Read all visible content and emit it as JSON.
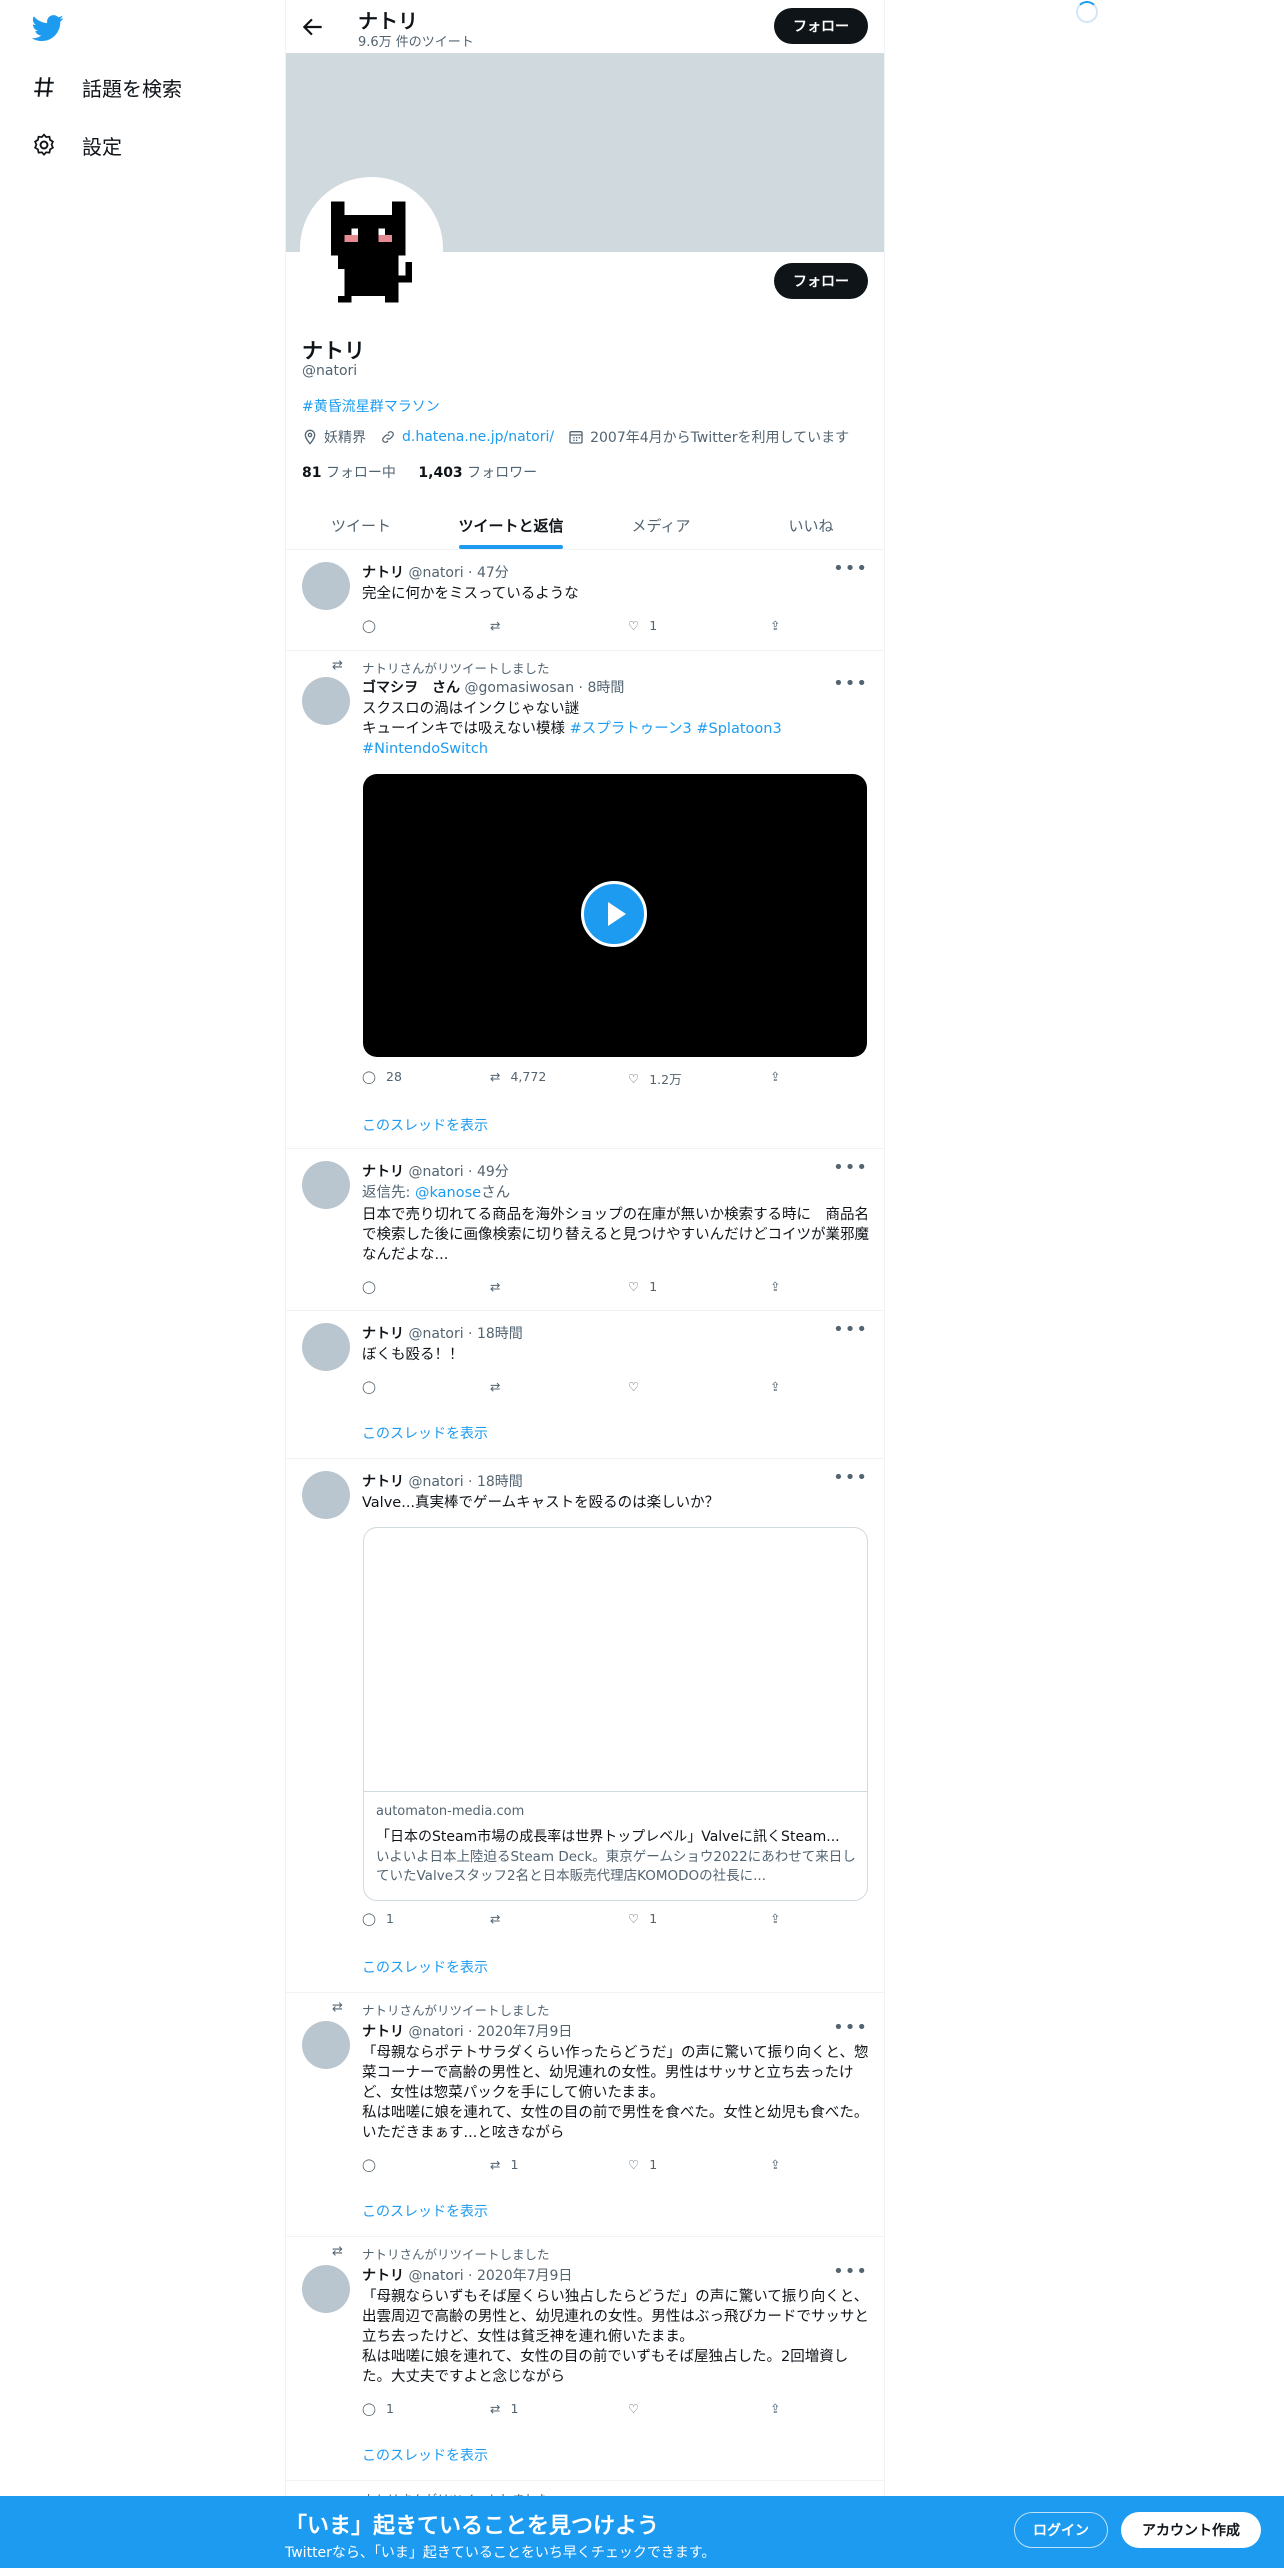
{
  "nav": {
    "explore_label": "話題を検索",
    "settings_label": "設定"
  },
  "header": {
    "name": "ナトリ",
    "tweet_count": "9.6万 件のツイート",
    "follow_label": "フォロー"
  },
  "profile": {
    "name": "ナトリ",
    "handle": "@natori",
    "bio_hashtag": "#黄昏流星群マラソン",
    "location": "妖精界",
    "url": "d.hatena.ne.jp/natori/",
    "joined": "2007年4月からTwitterを利用しています",
    "following_count": "81",
    "following_label": "フォロー中",
    "followers_count": "1,403",
    "followers_label": "フォロワー",
    "follow_label": "フォロー"
  },
  "tabs": [
    "ツイート",
    "ツイートと返信",
    "メディア",
    "いいね"
  ],
  "tweets": [
    {
      "name": "ナトリ",
      "handle": "@natori",
      "time": "47分",
      "text": "完全に何かをミスっているような",
      "reply": "",
      "retweet": "",
      "like": "1"
    },
    {
      "retweeted_by": "ナトリさんがリツイートしました",
      "name": "ゴマシヲ　さん",
      "handle": "@gomasiwosan",
      "time": "8時間",
      "text1": "スクスロの渦はインクじゃない謎",
      "text2": "キューインキでは吸えない模様 ",
      "tags": "#スプラトゥーン3 #Splatoon3",
      "tags2": "#NintendoSwitch",
      "reply": "28",
      "retweet": "4,772",
      "like": "1.2万",
      "show_thread": "このスレッドを表示"
    },
    {
      "name": "ナトリ",
      "handle": "@natori",
      "time": "49分",
      "reply_to_prefix": "返信先: ",
      "reply_to": "@kanose",
      "reply_to_suffix": "さん",
      "text": "日本で売り切れてる商品を海外ショップの在庫が無いか検索する時に　商品名で検索した後に画像検索に切り替えると見つけやすいんだけどコイツが業邪魔なんだよな...",
      "reply": "",
      "retweet": "",
      "like": "1"
    },
    {
      "name": "ナトリ",
      "handle": "@natori",
      "time": "18時間",
      "text": "ぼくも殴る！！",
      "reply": "",
      "retweet": "",
      "like": "",
      "show_thread": "このスレッドを表示"
    },
    {
      "name": "ナトリ",
      "handle": "@natori",
      "time": "18時間",
      "text": "Valve...真実棒でゲームキャストを殴るのは楽しいか？",
      "card_domain": "automaton-media.com",
      "card_title": "「日本のSteam市場の成長率は世界トップレベル」Valveに訊くSteam...",
      "card_desc": "いよいよ日本上陸迫るSteam Deck。東京ゲームショウ2022にあわせて来日していたValveスタッフ2名と日本販売代理店KOMODOの社長に...",
      "reply": "1",
      "retweet": "",
      "like": "1",
      "show_thread": "このスレッドを表示"
    },
    {
      "retweeted_by": "ナトリさんがリツイートしました",
      "name": "ナトリ",
      "handle": "@natori",
      "time": "2020年7月9日",
      "text": "「母親ならポテトサラダくらい作ったらどうだ」の声に驚いて振り向くと、惣菜コーナーで高齢の男性と、幼児連れの女性。男性はサッサと立ち去ったけど、女性は惣菜パックを手にして俯いたまま。",
      "text2": "私は咄嗟に娘を連れて、女性の目の前で男性を食べた。女性と幼児も食べた。いただきまぁす...と呟きながら",
      "reply": "",
      "retweet": "1",
      "like": "1",
      "show_thread": "このスレッドを表示"
    },
    {
      "retweeted_by": "ナトリさんがリツイートしました",
      "name": "ナトリ",
      "handle": "@natori",
      "time": "2020年7月9日",
      "text": "「母親ならいずもそば屋くらい独占したらどうだ」の声に驚いて振り向くと、出雲周辺で高齢の男性と、幼児連れの女性。男性はぶっ飛びカードでサッサと立ち去ったけど、女性は貧乏神を連れ俯いたまま。",
      "text2": "私は咄嗟に娘を連れて、女性の目の前でいずもそば屋独占した。2回増資した。大丈夫ですよと念じながら",
      "reply": "1",
      "retweet": "1",
      "like": "",
      "show_thread": "このスレッドを表示"
    }
  ],
  "partial_retweet": "ナトリさんがリツイートしました",
  "bottom": {
    "title": "「いま」起きていることを見つけよう",
    "subtitle": "Twitterなら、「いま」起きていることをいち早くチェックできます。",
    "login_label": "ログイン",
    "signup_label": "アカウント作成"
  },
  "colors": {
    "accent": "#1d9bf0",
    "banner": "#cfd9de",
    "dark": "#0f1419"
  }
}
